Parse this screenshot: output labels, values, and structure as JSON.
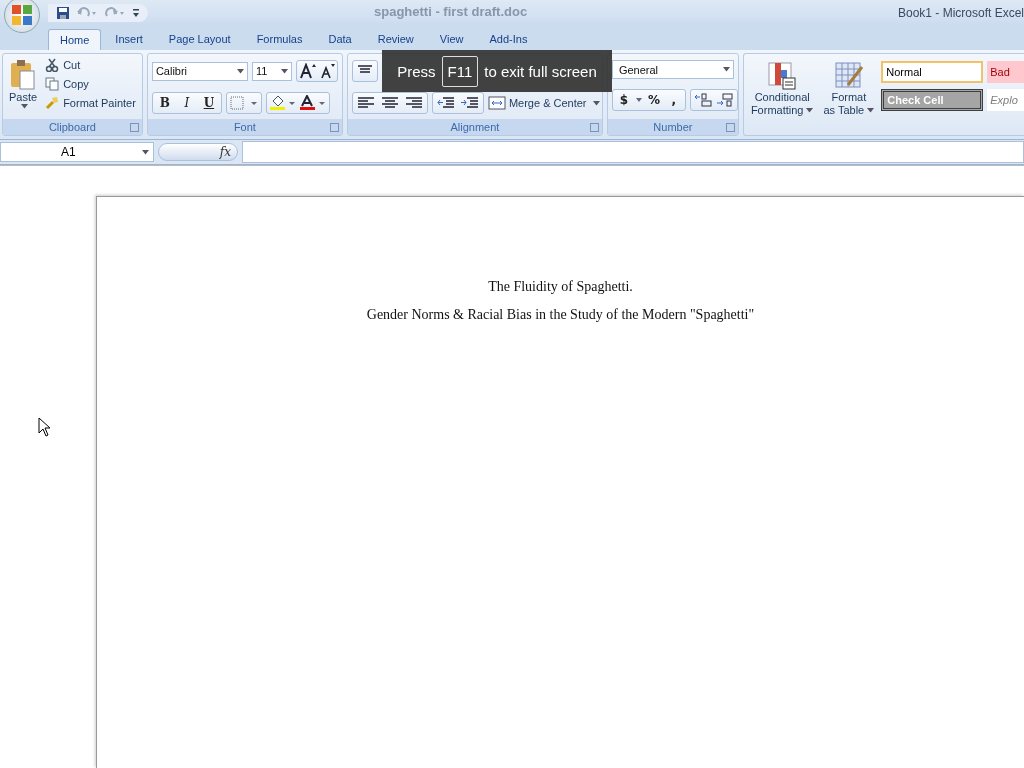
{
  "window": {
    "document_title": "spaghetti - first draft.doc",
    "app_title": "Book1 - Microsoft Excel"
  },
  "tabs": [
    {
      "label": "Home",
      "selected": true
    },
    {
      "label": "Insert",
      "selected": false
    },
    {
      "label": "Page Layout",
      "selected": false
    },
    {
      "label": "Formulas",
      "selected": false
    },
    {
      "label": "Data",
      "selected": false
    },
    {
      "label": "Review",
      "selected": false
    },
    {
      "label": "View",
      "selected": false
    },
    {
      "label": "Add-Ins",
      "selected": false
    }
  ],
  "ribbon": {
    "clipboard": {
      "label": "Clipboard",
      "paste": "Paste",
      "items": [
        "Cut",
        "Copy",
        "Format Painter"
      ]
    },
    "font": {
      "label": "Font",
      "name": "Calibri",
      "size": "11",
      "bold": "B",
      "italic": "I",
      "underline": "U"
    },
    "alignment": {
      "label": "Alignment",
      "merge": "Merge & Center"
    },
    "number": {
      "label": "Number",
      "format": "General",
      "currency": "$",
      "percent": "%",
      "comma": ","
    },
    "styles": {
      "conditional": [
        "Conditional",
        "Formatting"
      ],
      "format_table": [
        "Format",
        "as Table"
      ],
      "cell_styles": [
        {
          "label": "Normal",
          "kind": "normal"
        },
        {
          "label": "Bad",
          "kind": "bad"
        },
        {
          "label": "Check Cell",
          "kind": "check"
        },
        {
          "label": "Explo",
          "kind": "explanatory"
        }
      ]
    }
  },
  "formula_bar": {
    "name_box": "A1",
    "fx": "fx"
  },
  "fullscreen_notice": {
    "before": "Press",
    "key": "F11",
    "after": "to exit full screen"
  },
  "document": {
    "lines": [
      "The Fluidity of Spaghetti.",
      "Gender Norms & Racial Bias in the Study of the Modern \"Spaghetti\""
    ]
  }
}
